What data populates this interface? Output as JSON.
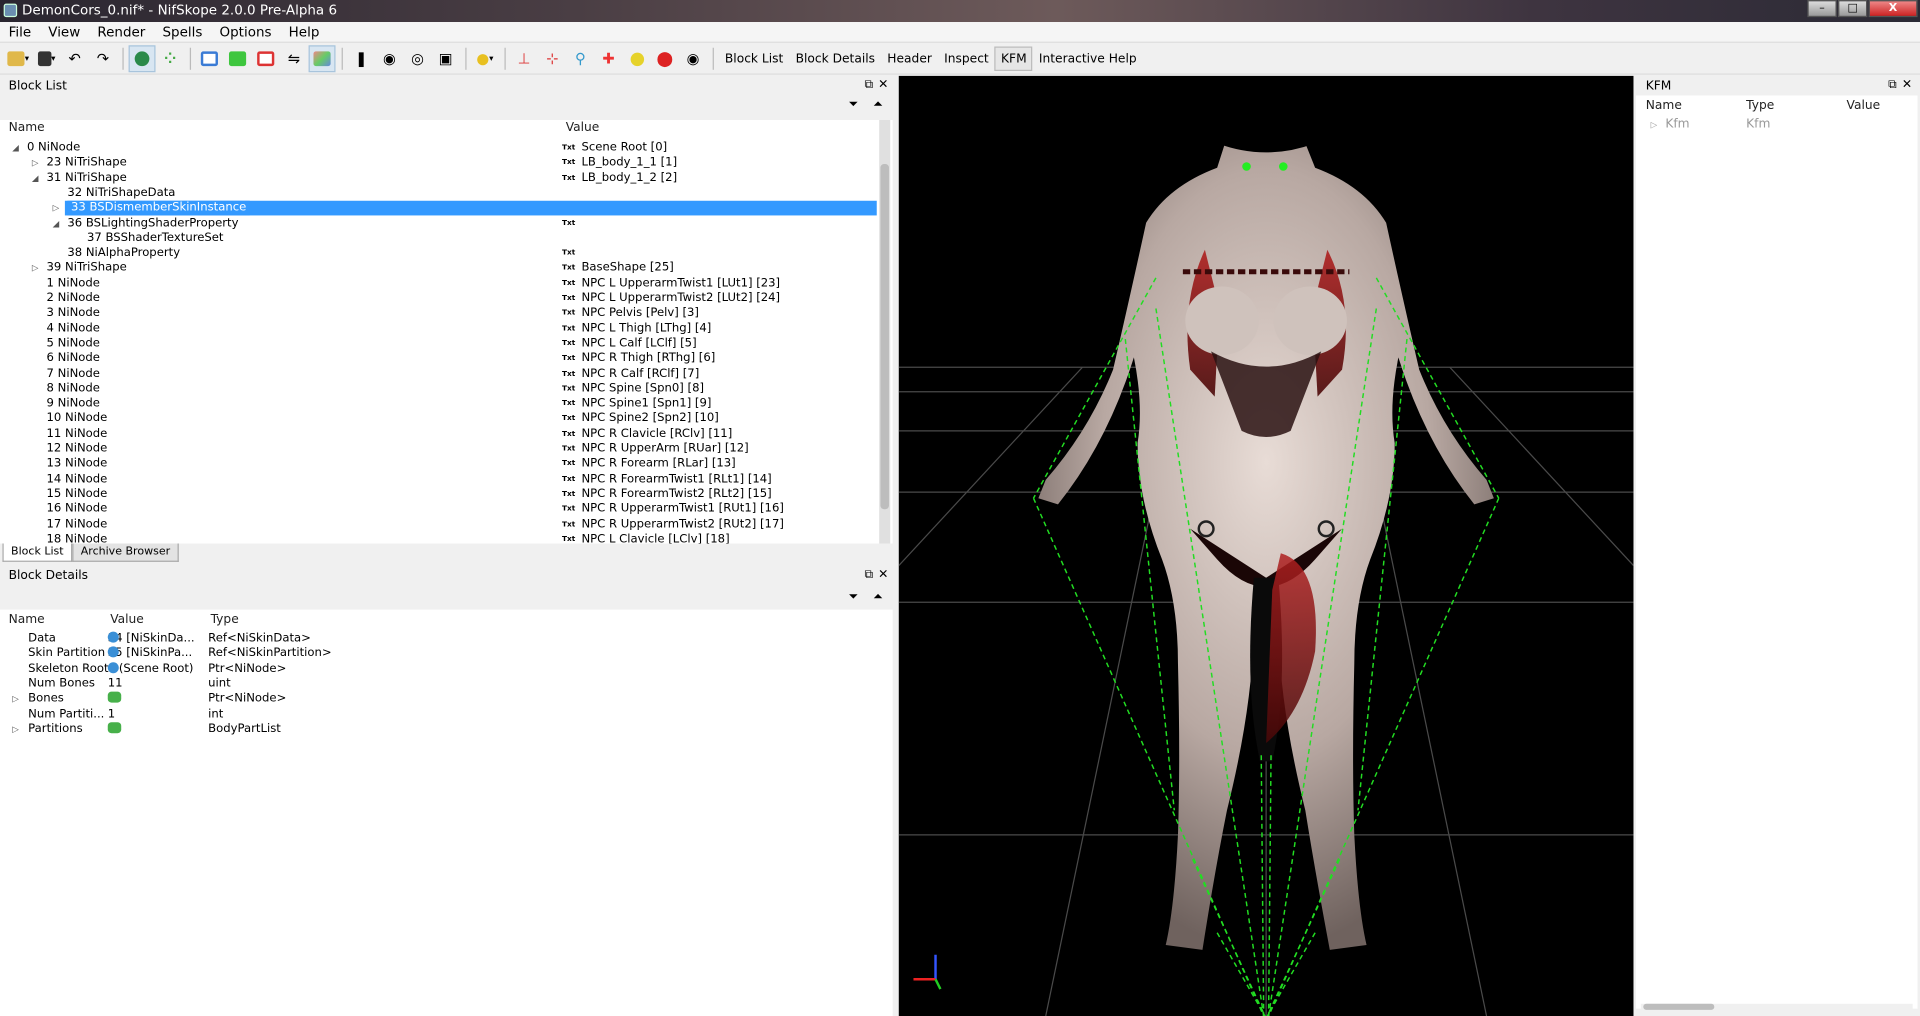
{
  "window": {
    "title": "DemonCors_0.nif* - NifSkope 2.0.0 Pre-Alpha 6",
    "min": "–",
    "max": "□",
    "close": "X"
  },
  "menu": [
    "File",
    "View",
    "Render",
    "Spells",
    "Options",
    "Help"
  ],
  "toolbar": {
    "text_buttons": [
      "Block List",
      "Block Details",
      "Header",
      "Inspect",
      "KFM",
      "Interactive Help"
    ]
  },
  "block_list": {
    "title": "Block List",
    "columns": [
      "Name",
      "Value"
    ],
    "txt_badge": "Txt",
    "rows": [
      {
        "name": "0 NiNode",
        "value": "Scene Root [0]",
        "indent": 0,
        "tri": "open",
        "txt": true
      },
      {
        "name": "23 NiTriShape",
        "value": "LB_body_1_1 [1]",
        "indent": 1,
        "tri": "closed",
        "txt": true
      },
      {
        "name": "31 NiTriShape",
        "value": "LB_body_1_2 [2]",
        "indent": 1,
        "tri": "open",
        "txt": true
      },
      {
        "name": "32 NiTriShapeData",
        "value": "",
        "indent": 2,
        "tri": "",
        "txt": false
      },
      {
        "name": "33 BSDismemberSkinInstance",
        "value": "",
        "indent": 2,
        "tri": "closed",
        "txt": false,
        "selected": true
      },
      {
        "name": "36 BSLightingShaderProperty",
        "value": "",
        "indent": 2,
        "tri": "open",
        "txt": true
      },
      {
        "name": "37 BSShaderTextureSet",
        "value": "",
        "indent": 3,
        "tri": "",
        "txt": false
      },
      {
        "name": "38 NiAlphaProperty",
        "value": "",
        "indent": 2,
        "tri": "",
        "txt": true
      },
      {
        "name": "39 NiTriShape",
        "value": "BaseShape [25]",
        "indent": 1,
        "tri": "closed",
        "txt": true
      },
      {
        "name": "1 NiNode",
        "value": "NPC L UpperarmTwist1 [LUt1] [23]",
        "indent": 1,
        "tri": "",
        "txt": true
      },
      {
        "name": "2 NiNode",
        "value": "NPC L UpperarmTwist2 [LUt2] [24]",
        "indent": 1,
        "tri": "",
        "txt": true
      },
      {
        "name": "3 NiNode",
        "value": "NPC Pelvis [Pelv] [3]",
        "indent": 1,
        "tri": "",
        "txt": true
      },
      {
        "name": "4 NiNode",
        "value": "NPC L Thigh [LThg] [4]",
        "indent": 1,
        "tri": "",
        "txt": true
      },
      {
        "name": "5 NiNode",
        "value": "NPC L Calf [LClf] [5]",
        "indent": 1,
        "tri": "",
        "txt": true
      },
      {
        "name": "6 NiNode",
        "value": "NPC R Thigh [RThg] [6]",
        "indent": 1,
        "tri": "",
        "txt": true
      },
      {
        "name": "7 NiNode",
        "value": "NPC R Calf [RClf] [7]",
        "indent": 1,
        "tri": "",
        "txt": true
      },
      {
        "name": "8 NiNode",
        "value": "NPC Spine [Spn0] [8]",
        "indent": 1,
        "tri": "",
        "txt": true
      },
      {
        "name": "9 NiNode",
        "value": "NPC Spine1 [Spn1] [9]",
        "indent": 1,
        "tri": "",
        "txt": true
      },
      {
        "name": "10 NiNode",
        "value": "NPC Spine2 [Spn2] [10]",
        "indent": 1,
        "tri": "",
        "txt": true
      },
      {
        "name": "11 NiNode",
        "value": "NPC R Clavicle [RClv] [11]",
        "indent": 1,
        "tri": "",
        "txt": true
      },
      {
        "name": "12 NiNode",
        "value": "NPC R UpperArm [RUar] [12]",
        "indent": 1,
        "tri": "",
        "txt": true
      },
      {
        "name": "13 NiNode",
        "value": "NPC R Forearm [RLar] [13]",
        "indent": 1,
        "tri": "",
        "txt": true
      },
      {
        "name": "14 NiNode",
        "value": "NPC R ForearmTwist1 [RLt1] [14]",
        "indent": 1,
        "tri": "",
        "txt": true
      },
      {
        "name": "15 NiNode",
        "value": "NPC R ForearmTwist2 [RLt2] [15]",
        "indent": 1,
        "tri": "",
        "txt": true
      },
      {
        "name": "16 NiNode",
        "value": "NPC R UpperarmTwist1 [RUt1] [16]",
        "indent": 1,
        "tri": "",
        "txt": true
      },
      {
        "name": "17 NiNode",
        "value": "NPC R UpperarmTwist2 [RUt2] [17]",
        "indent": 1,
        "tri": "",
        "txt": true
      },
      {
        "name": "18 NiNode",
        "value": "NPC L Clavicle [LClv] [18]",
        "indent": 1,
        "tri": "",
        "txt": true
      }
    ]
  },
  "tabs": [
    "Block List",
    "Archive Browser"
  ],
  "block_details": {
    "title": "Block Details",
    "columns": [
      "Name",
      "Value",
      "Type"
    ],
    "rows": [
      {
        "name": "Data",
        "value": "34 [NiSkinDa...",
        "type": "Ref<NiSkinData>",
        "icon": "ref",
        "tri": false
      },
      {
        "name": "Skin Partition",
        "value": "35 [NiSkinPa...",
        "type": "Ref<NiSkinPartition>",
        "icon": "ref",
        "tri": false
      },
      {
        "name": "Skeleton Root",
        "value": "0 (Scene Root)",
        "type": "Ptr<NiNode>",
        "icon": "ref",
        "tri": false
      },
      {
        "name": "Num Bones",
        "value": "11",
        "type": "uint",
        "icon": "",
        "tri": false
      },
      {
        "name": "Bones",
        "value": "",
        "type": "Ptr<NiNode>",
        "icon": "grp",
        "tri": true
      },
      {
        "name": "Num Partiti...",
        "value": "1",
        "type": "int",
        "icon": "",
        "tri": false
      },
      {
        "name": "Partitions",
        "value": "",
        "type": "BodyPartList",
        "icon": "grp",
        "tri": true
      }
    ]
  },
  "kfm": {
    "title": "KFM",
    "columns": [
      "Name",
      "Type",
      "Value"
    ],
    "rows": [
      {
        "name": "Kfm",
        "type": "Kfm",
        "value": ""
      }
    ]
  },
  "colors": {
    "selection": "#3399ff",
    "viewport_bg": "#000000",
    "grid": "#4a4a4a",
    "bones": "#22dd22"
  }
}
